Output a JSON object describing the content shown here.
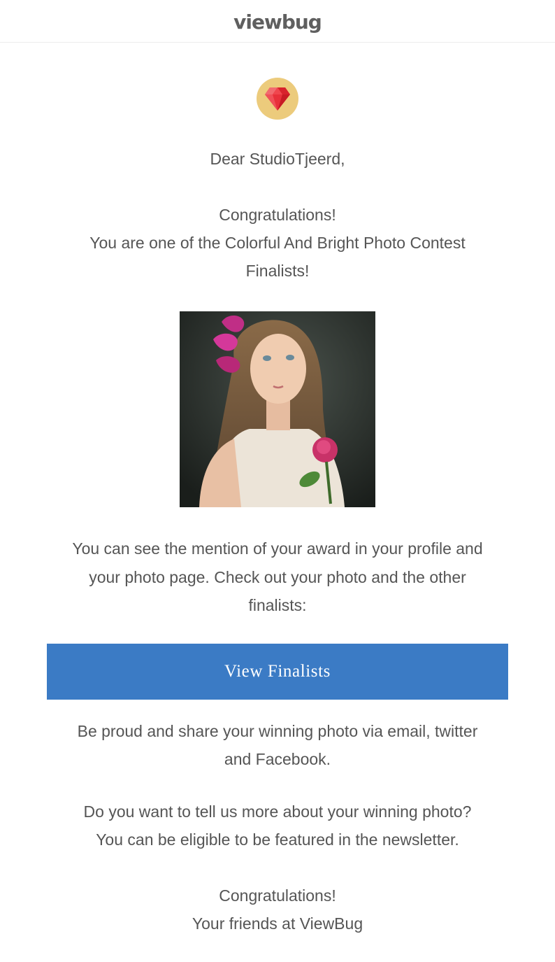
{
  "header": {
    "logo_text": "viewbug"
  },
  "badge": {
    "icon": "ruby-gem-icon",
    "colors": {
      "circle": "#eccb7c",
      "gem": "#e8303a"
    }
  },
  "greeting": "Dear StudioTjeerd,",
  "congrats": {
    "line1": "Congratulations!",
    "line2": "You are one of the Colorful And Bright Photo Contest",
    "line3": "Finalists!"
  },
  "photo": {
    "subject": "finalist-photo-girl-with-rose"
  },
  "mention": {
    "line1": "You can see the mention of your award in your profile and",
    "line2": "your photo page. Check out your photo and the other",
    "line3": "finalists:"
  },
  "cta": {
    "label": "View Finalists",
    "color": "#3b7bc5"
  },
  "share": {
    "line1": "Be proud and share your winning photo via email, twitter",
    "line2": "and Facebook."
  },
  "tell_more": {
    "line1": "Do you want to tell us more about your winning photo?",
    "line2": "You can be eligible to be featured in the newsletter."
  },
  "signoff": {
    "line1": "Congratulations!",
    "line2": "Your friends at ViewBug"
  }
}
